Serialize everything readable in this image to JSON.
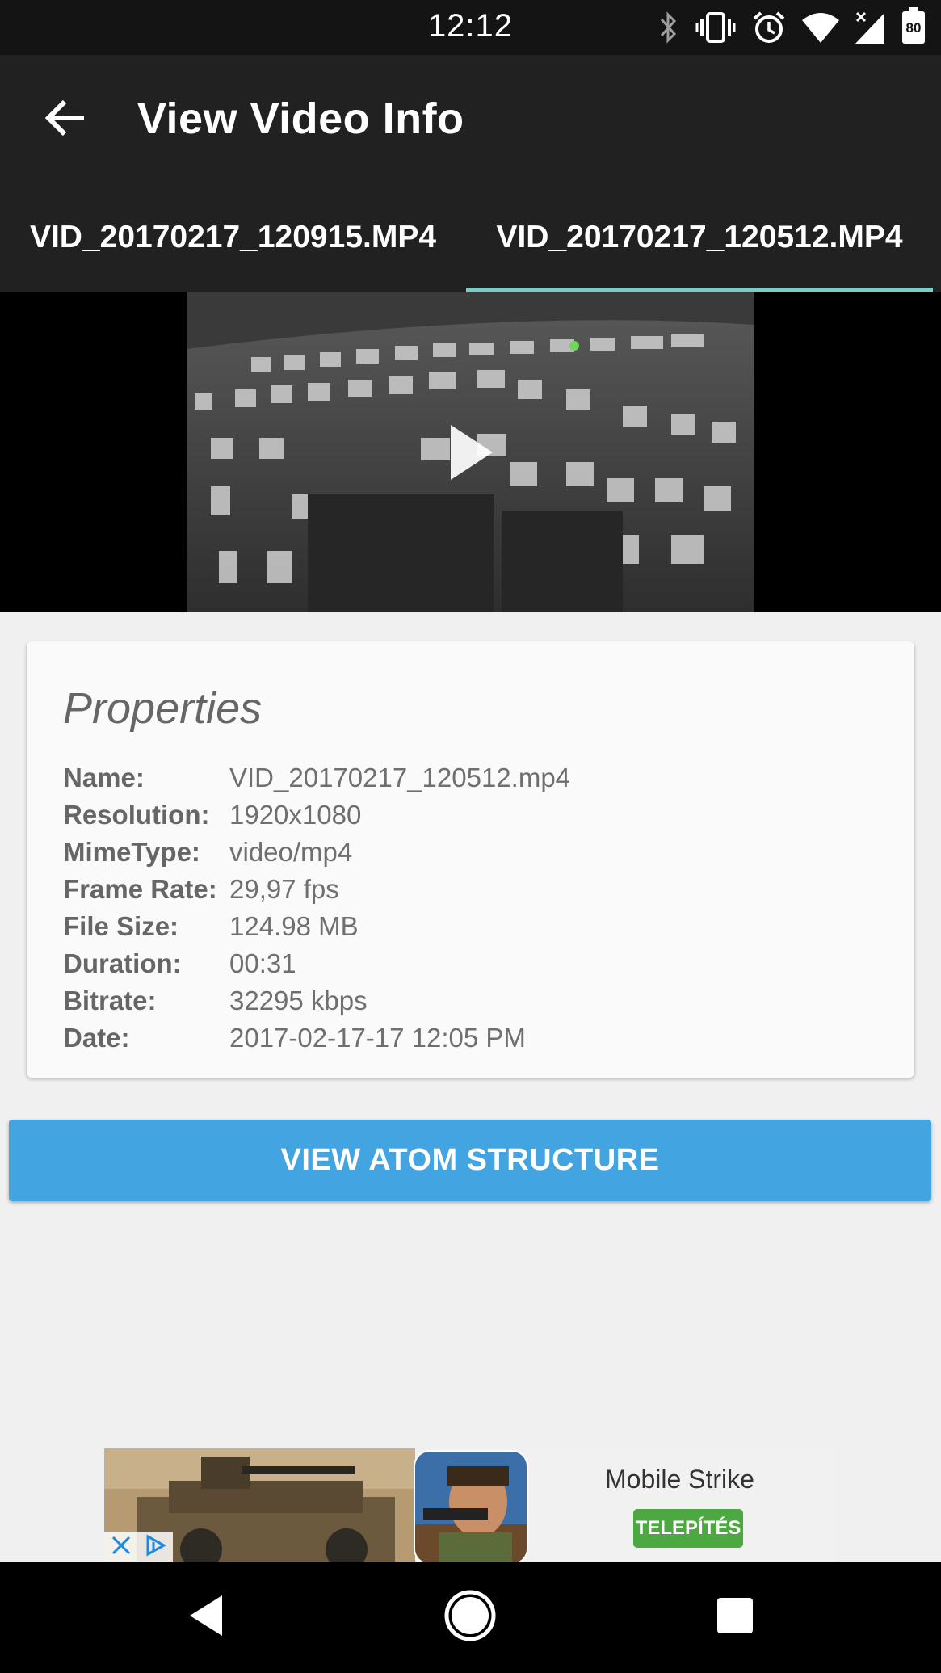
{
  "status_bar": {
    "time": "12:12",
    "battery_level": "80",
    "icons": [
      "bluetooth-icon",
      "vibrate-icon",
      "alarm-icon",
      "wifi-icon",
      "cell-signal-icon",
      "battery-icon"
    ]
  },
  "app_bar": {
    "back_icon": "arrow-back-icon",
    "title": "View Video Info"
  },
  "tabs": [
    {
      "label": "VID_20170217_120915.MP4",
      "selected": false
    },
    {
      "label": "VID_20170217_120512.MP4",
      "selected": true
    }
  ],
  "video": {
    "play_icon": "play-icon"
  },
  "properties": {
    "title": "Properties",
    "rows": [
      {
        "label": "Name:",
        "value": "VID_20170217_120512.mp4"
      },
      {
        "label": "Resolution:",
        "value": "1920x1080"
      },
      {
        "label": "MimeType:",
        "value": "video/mp4"
      },
      {
        "label": "Frame Rate:",
        "value": "29,97 fps"
      },
      {
        "label": "File Size:",
        "value": "124.98 MB"
      },
      {
        "label": "Duration:",
        "value": "00:31"
      },
      {
        "label": "Bitrate:",
        "value": "32295 kbps"
      },
      {
        "label": "Date:",
        "value": "2017-02-17-17 12:05 PM"
      }
    ]
  },
  "atom_button": {
    "label": "VIEW ATOM STRUCTURE"
  },
  "ad": {
    "app_name": "Mobile Strike",
    "install_label": "TELEPÍTÉS"
  },
  "nav": {
    "back": "nav-back-icon",
    "home": "nav-home-icon",
    "recents": "nav-recents-icon"
  },
  "colors": {
    "toolbar": "#212121",
    "tab_indicator": "#80cbc4",
    "button": "#42a4e1",
    "install": "#4ea842"
  }
}
